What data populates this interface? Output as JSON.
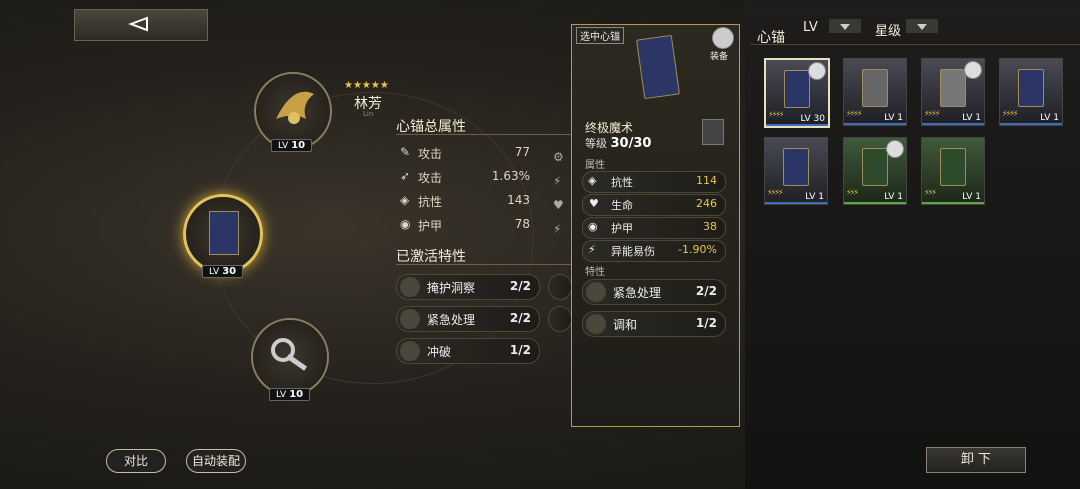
{
  "character": {
    "name": "林芳",
    "subname": "Lin",
    "stars": "★★★★★"
  },
  "slots": [
    {
      "lv_label": "LV",
      "lv": "10"
    },
    {
      "lv_label": "LV",
      "lv": "30"
    },
    {
      "lv_label": "LV",
      "lv": "10"
    }
  ],
  "stats_section": {
    "title": "心锚总属性",
    "rows": [
      {
        "label": "攻击",
        "value": "77"
      },
      {
        "label": "攻击",
        "value": "1.63%"
      },
      {
        "label": "抗性",
        "value": "143"
      },
      {
        "label": "护甲",
        "value": "78"
      }
    ]
  },
  "traits_section": {
    "title": "已激活特性",
    "items": [
      {
        "name": "掩护洞察",
        "count": "2/2"
      },
      {
        "name": "紧急处理",
        "count": "2/2"
      },
      {
        "name": "冲破",
        "count": "1/2"
      }
    ]
  },
  "detail": {
    "tag": "选中心锚",
    "equipped": "装备",
    "name": "终极魔术",
    "level_label": "等级",
    "level": "30/30",
    "attr_header": "属性",
    "attrs": [
      {
        "label": "抗性",
        "value": "114"
      },
      {
        "label": "生命",
        "value": "246"
      },
      {
        "label": "护甲",
        "value": "38"
      },
      {
        "label": "异能易伤",
        "value": "-1.90%"
      }
    ],
    "trait_header": "特性",
    "traits": [
      {
        "name": "紧急处理",
        "count": "2/2"
      },
      {
        "name": "调和",
        "count": "1/2"
      }
    ]
  },
  "inventory": {
    "title": "心锚",
    "sort_lv": "LV",
    "sort_star": "星级",
    "cards": [
      {
        "stars": "⚡⚡⚡⚡",
        "lv": "LV 30"
      },
      {
        "stars": "⚡⚡⚡⚡",
        "lv": "LV 1"
      },
      {
        "stars": "⚡⚡⚡⚡",
        "lv": "LV 1"
      },
      {
        "stars": "⚡⚡⚡⚡",
        "lv": "LV 1"
      },
      {
        "stars": "⚡⚡⚡⚡",
        "lv": "LV 1"
      },
      {
        "stars": "⚡⚡⚡",
        "lv": "LV 1"
      },
      {
        "stars": "⚡⚡⚡",
        "lv": "LV 1"
      }
    ]
  },
  "buttons": {
    "compare": "对比",
    "auto_equip": "自动装配",
    "unequip": "卸 下"
  },
  "colors": {
    "accent_gold": "#e3c25a",
    "panel_border": "#b89a52",
    "value_gold": "#e8c64a",
    "rare_blue": "#3d6fb8",
    "uncommon_green": "#5aa64a"
  }
}
